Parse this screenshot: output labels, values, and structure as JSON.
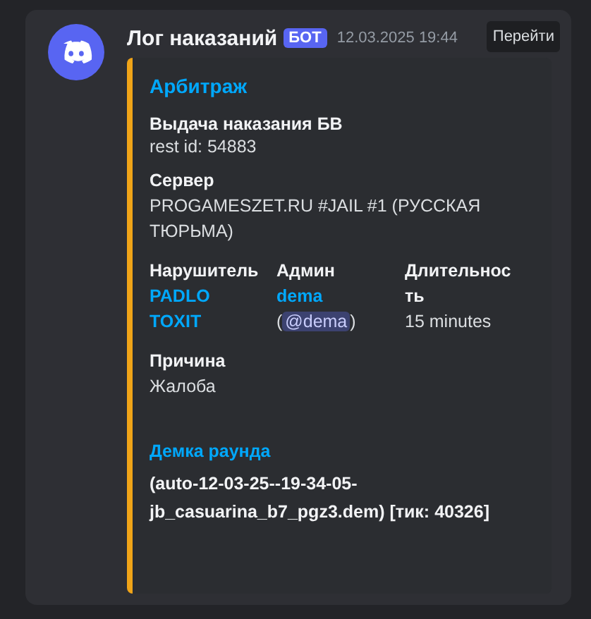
{
  "message": {
    "author": "Лог наказаний",
    "badge": "БОТ",
    "timestamp": "12.03.2025 19:44",
    "jump_button": "Перейти"
  },
  "embed": {
    "color": "#f0a418",
    "title": "Арбитраж",
    "description_title": "Выдача наказания БВ",
    "description": "rest id: 54883",
    "fields": [
      {
        "name": "Сервер",
        "value": "PROGAMESZET.RU #JAIL #1 (РУССКАЯ ТЮРЬМА)",
        "kind": "text",
        "inline": false
      },
      {
        "name": "Нарушитель",
        "value": "PADLO TOXIT",
        "kind": "link",
        "inline": true
      },
      {
        "name": "Админ",
        "value": "dema",
        "mention_open": "(",
        "mention": "@dema",
        "mention_close": ")",
        "kind": "user",
        "inline": true
      },
      {
        "name": "Длительность",
        "value": "15 minutes",
        "kind": "text",
        "inline": true
      },
      {
        "name": "Причина",
        "value": "Жалоба",
        "kind": "text",
        "inline": false
      }
    ],
    "section_title": "Демка раунда",
    "section_text": "(auto-12-03-25--19-34-05-jb_casuarina_b7_pgz3.dem) [тик: 40326]"
  }
}
